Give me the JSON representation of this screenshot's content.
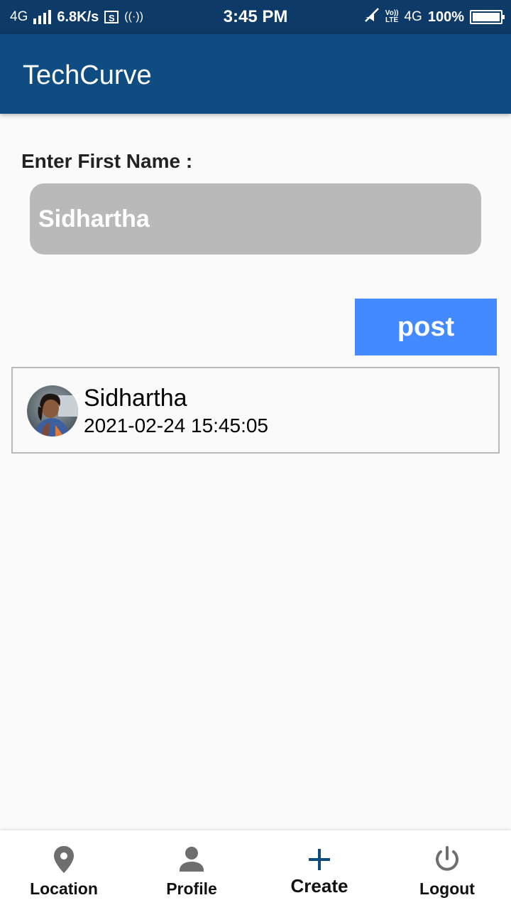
{
  "status_bar": {
    "network_left": "4G",
    "data_speed": "6.8K/s",
    "screenshot_icon_letter": "S",
    "hotspot_text": "((·))",
    "time": "3:45 PM",
    "volte_top": "Vo))",
    "volte_bottom": "LTE",
    "network_right": "4G",
    "battery": "100%",
    "battery_level": 1.0,
    "icons": [
      "signal-icon",
      "screenshot-icon",
      "hotspot-icon",
      "mute-icon",
      "volte-icon",
      "battery-icon"
    ]
  },
  "app_bar": {
    "title": "TechCurve",
    "color": "#0f4c81"
  },
  "form": {
    "label": "Enter First Name :",
    "input_value": "Sidhartha",
    "input_placeholder": "",
    "post_label": "post",
    "post_color": "#448aff"
  },
  "posts": [
    {
      "name": "Sidhartha",
      "timestamp": "2021-02-24 15:45:05",
      "avatar": "person-photo"
    }
  ],
  "bottom_nav": {
    "items": [
      {
        "label": "Location",
        "icon": "location-pin-icon"
      },
      {
        "label": "Profile",
        "icon": "person-icon"
      },
      {
        "label": "Create",
        "icon": "plus-icon",
        "active": true
      },
      {
        "label": "Logout",
        "icon": "power-icon"
      }
    ],
    "active_color": "#0f4c81",
    "icon_color": "#6e6e6e"
  }
}
